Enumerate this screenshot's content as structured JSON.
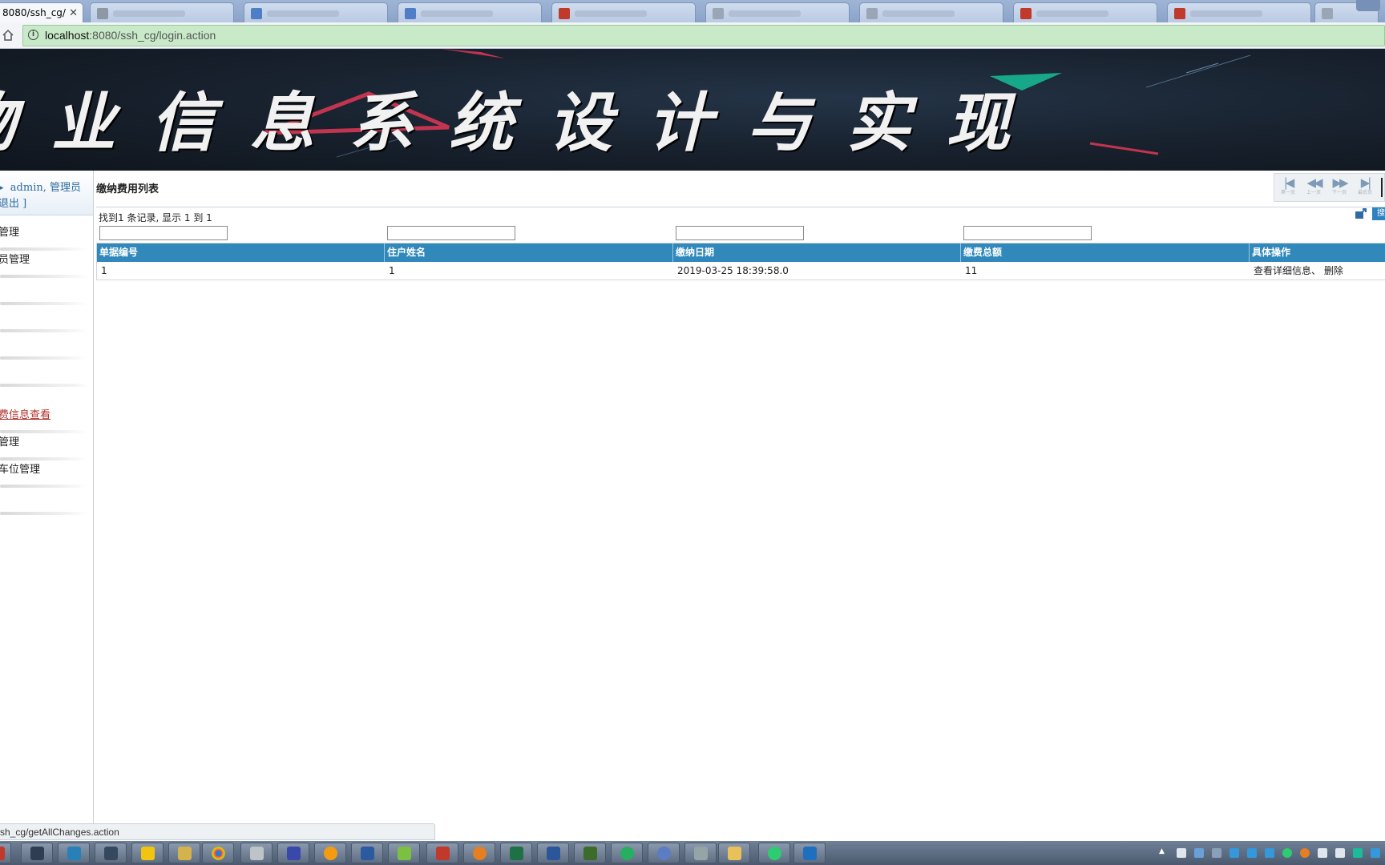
{
  "browser": {
    "active_tab_title": "8080/ssh_cg/",
    "url_host": "localhost",
    "url_rest": ":8080/ssh_cg/login.action",
    "status_url": "sh_cg/getAllChanges.action"
  },
  "banner": {
    "title": "物业信息系统设计与实现"
  },
  "sidebar": {
    "user_line": "admin, 管理员",
    "logout_line": "退出 ]",
    "items": [
      {
        "label": "管理"
      },
      {
        "label": "员管理"
      },
      {
        "label": ""
      },
      {
        "label": ""
      },
      {
        "label": ""
      },
      {
        "label": ""
      },
      {
        "label": ""
      },
      {
        "label": "费信息查看"
      },
      {
        "label": "管理"
      },
      {
        "label": "车位管理"
      },
      {
        "label": ""
      }
    ]
  },
  "main": {
    "title": "缴纳费用列表",
    "summary": "找到1 条记录, 显示 1 到 1",
    "pager": {
      "first": "第一页",
      "prev": "上一页",
      "next": "下一页",
      "last": "最后页"
    },
    "blue_button": "搜"
  },
  "table": {
    "columns": [
      "单据编号",
      "住户姓名",
      "缴纳日期",
      "缴费总额",
      "具体操作"
    ],
    "rows": [
      [
        "1",
        "1",
        "2019-03-25 18:39:58.0",
        "11",
        "查看详细信息、 删除"
      ]
    ]
  },
  "icons": {
    "home": "home-icon",
    "info": "info-icon",
    "export": "export-icon"
  },
  "colors": {
    "grid_header": "#3189bb",
    "link_red": "#b0332d",
    "omnibox_green": "#c8eac8"
  }
}
